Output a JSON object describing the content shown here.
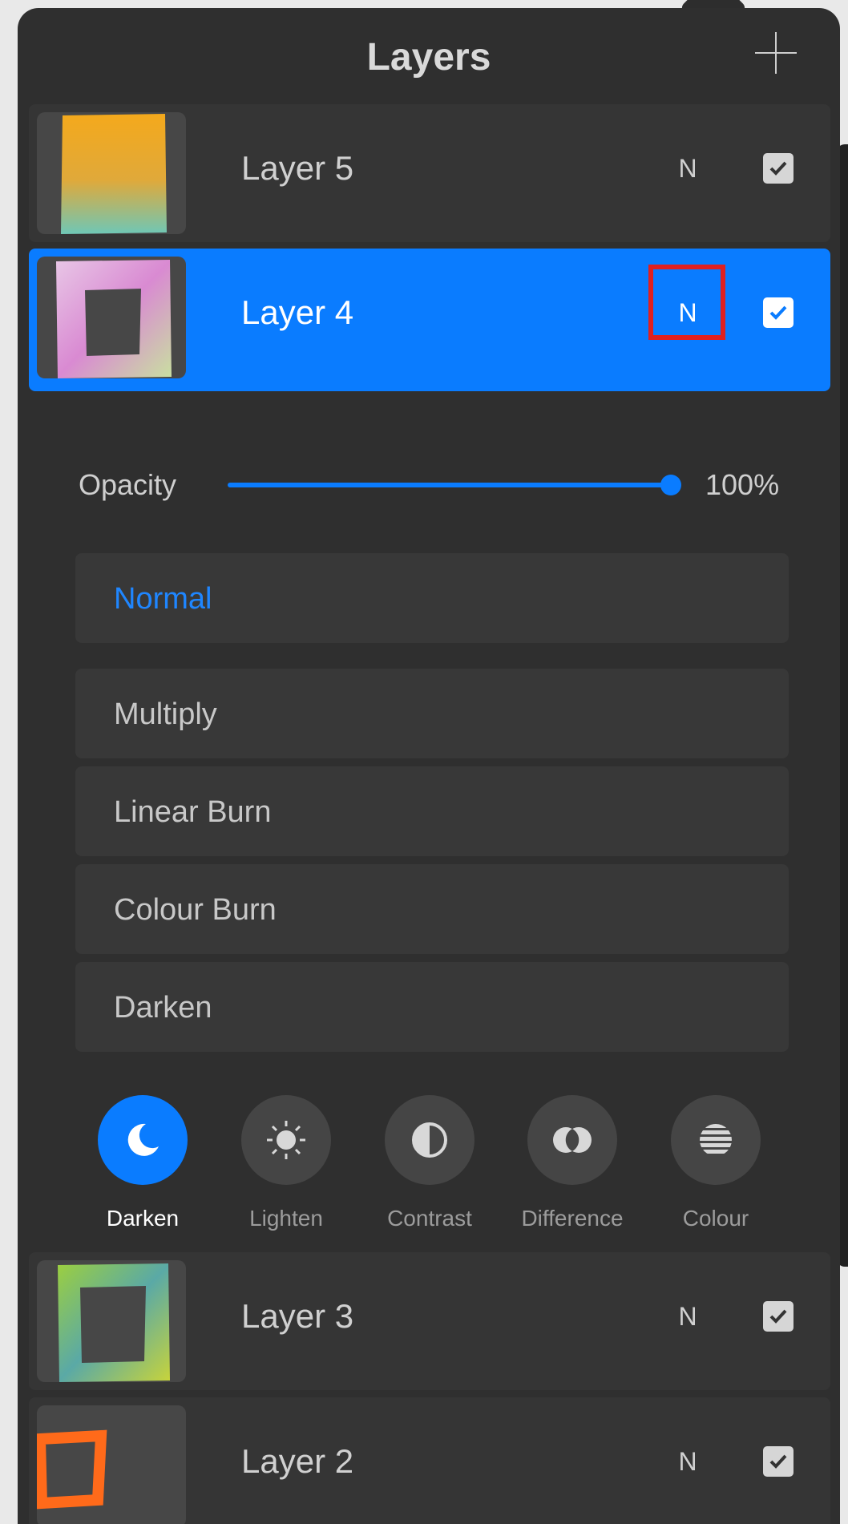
{
  "header": {
    "title": "Layers"
  },
  "layers": [
    {
      "name": "Layer 5",
      "blend": "N",
      "visible": true,
      "selected": false
    },
    {
      "name": "Layer 4",
      "blend": "N",
      "visible": true,
      "selected": true
    },
    {
      "name": "Layer 3",
      "blend": "N",
      "visible": true,
      "selected": false
    },
    {
      "name": "Layer 2",
      "blend": "N",
      "visible": true,
      "selected": false
    }
  ],
  "opacity": {
    "label": "Opacity",
    "value": "100%",
    "level": 1.0
  },
  "blend_modes": {
    "current": "Normal",
    "items": [
      "Multiply",
      "Linear Burn",
      "Colour Burn",
      "Darken"
    ]
  },
  "categories": [
    {
      "label": "Darken",
      "icon": "moon-icon",
      "active": true
    },
    {
      "label": "Lighten",
      "icon": "sun-icon",
      "active": false
    },
    {
      "label": "Contrast",
      "icon": "contrast-icon",
      "active": false
    },
    {
      "label": "Difference",
      "icon": "difference-icon",
      "active": false
    },
    {
      "label": "Colour",
      "icon": "colour-icon",
      "active": false
    }
  ],
  "colors": {
    "accent": "#0a7cff",
    "panel": "#2f2f2f",
    "highlight": "#e02020"
  }
}
